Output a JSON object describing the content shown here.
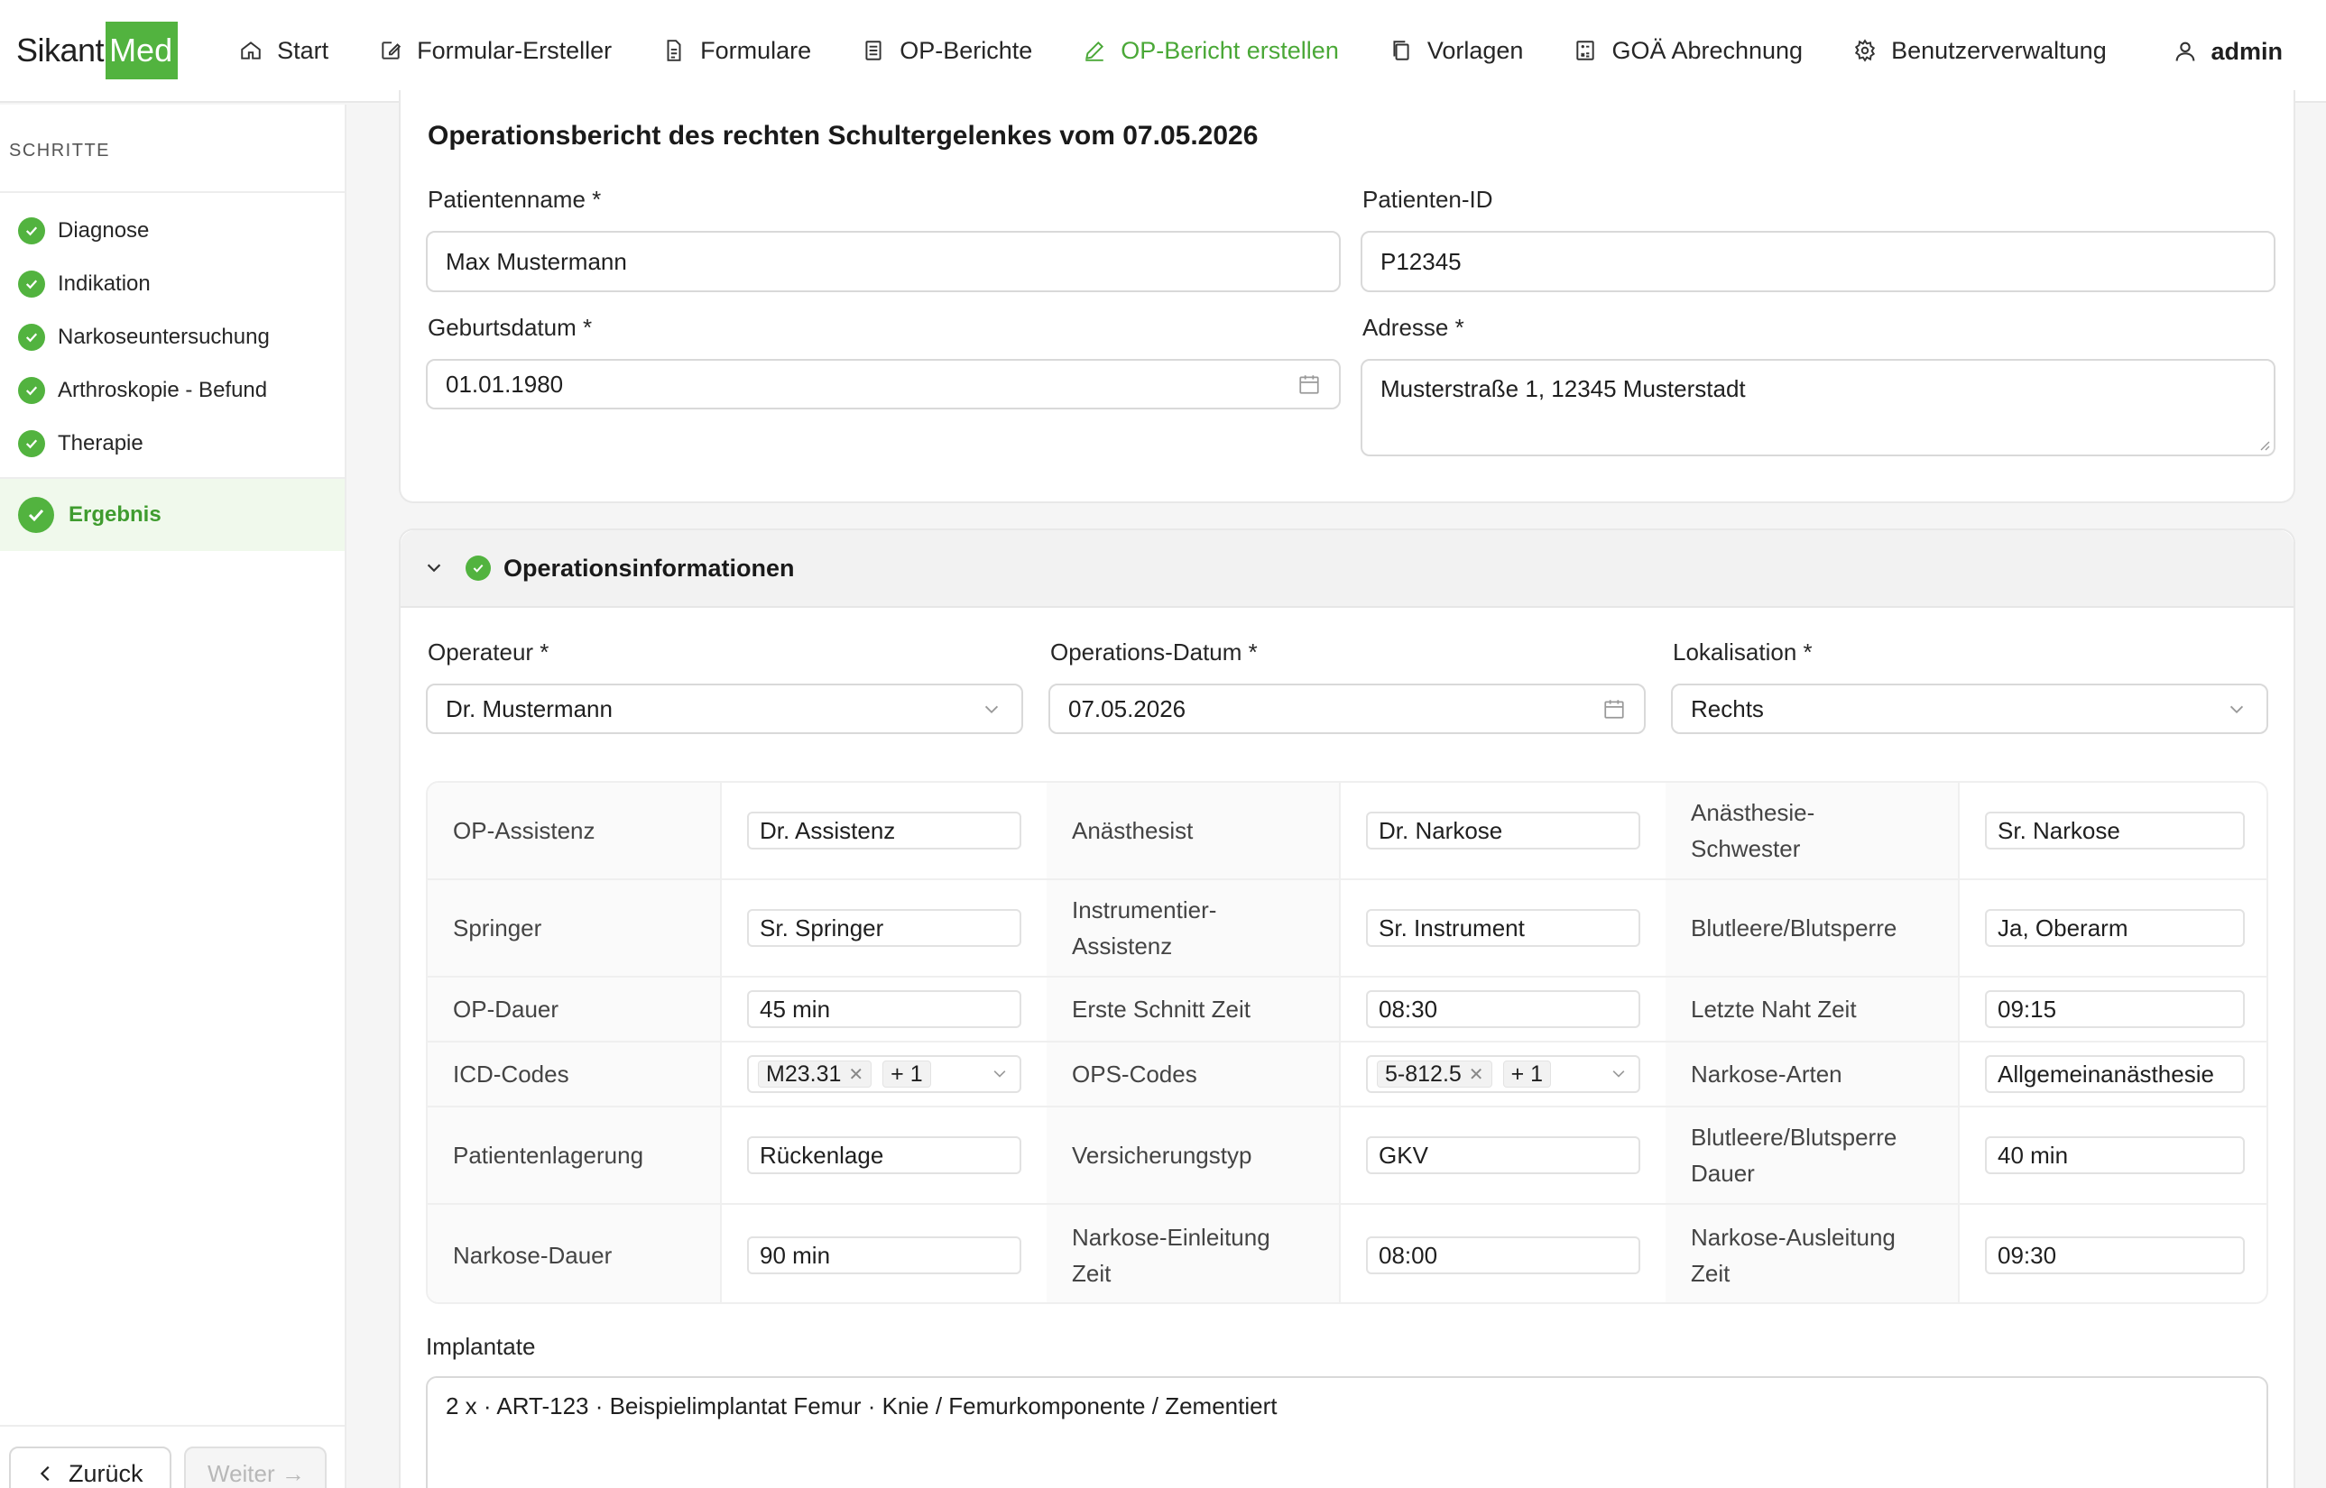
{
  "brand": {
    "name_part1": "Sikant",
    "name_part2": "Med"
  },
  "nav": {
    "items": [
      {
        "label": "Start",
        "icon": "home-icon"
      },
      {
        "label": "Formular-Ersteller",
        "icon": "edit-icon"
      },
      {
        "label": "Formulare",
        "icon": "document-icon"
      },
      {
        "label": "OP-Berichte",
        "icon": "list-icon"
      },
      {
        "label": "OP-Bericht erstellen",
        "icon": "pen-icon",
        "active": true
      },
      {
        "label": "Vorlagen",
        "icon": "copy-icon"
      },
      {
        "label": "GOÄ Abrechnung",
        "icon": "calculator-icon"
      },
      {
        "label": "Benutzerverwaltung",
        "icon": "gear-icon"
      }
    ],
    "user": "admin"
  },
  "sidebar": {
    "title": "SCHRITTE",
    "steps": [
      {
        "label": "Diagnose"
      },
      {
        "label": "Indikation"
      },
      {
        "label": "Narkoseuntersuchung"
      },
      {
        "label": "Arthroskopie - Befund"
      },
      {
        "label": "Therapie"
      }
    ],
    "active_step": "Ergebnis",
    "back_label": "Zurück",
    "next_label": "Weiter →"
  },
  "report": {
    "title": "Operationsbericht des rechten Schultergelenkes vom 07.05.2026",
    "patient_name_label": "Patientenname *",
    "patient_name": "Max Mustermann",
    "patient_id_label": "Patienten-ID",
    "patient_id": "P12345",
    "birthdate_label": "Geburtsdatum *",
    "birthdate": "01.01.1980",
    "address_label": "Adresse *",
    "address": "Musterstraße 1, 12345 Musterstadt"
  },
  "op_info": {
    "section_title": "Operationsinformationen",
    "operator_label": "Operateur *",
    "operator": "Dr. Mustermann",
    "date_label": "Operations-Datum *",
    "date": "07.05.2026",
    "location_label": "Lokalisation *",
    "location": "Rechts",
    "grid": [
      {
        "l1": "OP-Assistenz",
        "v1": "Dr. Assistenz",
        "l2": "Anästhesist",
        "v2": "Dr. Narkose",
        "l3": "Anästhesie-Schwester",
        "v3": "Sr. Narkose"
      },
      {
        "l1": "Springer",
        "v1": "Sr. Springer",
        "l2": "Instrumentier-Assistenz",
        "v2": "Sr. Instrument",
        "l3": "Blutleere/Blutsperre",
        "v3": "Ja, Oberarm"
      },
      {
        "l1": "OP-Dauer",
        "v1": "45 min",
        "l2": "Erste Schnitt Zeit",
        "v2": "08:30",
        "l3": "Letzte Naht Zeit",
        "v3": "09:15"
      },
      {
        "l1": "ICD-Codes",
        "v1_tag": "M23.31",
        "v1_more": "+ 1",
        "l2": "OPS-Codes",
        "v2_tag": "5-812.5",
        "v2_more": "+ 1",
        "l3": "Narkose-Arten",
        "v3": "Allgemeinanästhesie"
      },
      {
        "l1": "Patientenlagerung",
        "v1": "Rückenlage",
        "l2": "Versicherungstyp",
        "v2": "GKV",
        "l3": "Blutleere/Blutsperre Dauer",
        "v3": "40 min"
      },
      {
        "l1": "Narkose-Dauer",
        "v1": "90 min",
        "l2": "Narkose-Einleitung Zeit",
        "v2": "08:00",
        "l3": "Narkose-Ausleitung Zeit",
        "v3": "09:30"
      }
    ],
    "implants_label": "Implantate",
    "implants_text": "2 x · ART-123 · Beispielimplantat Femur · Knie / Femurkomponente / Zementiert"
  },
  "colors": {
    "accent": "#52b33f",
    "accent_text": "#4aa837"
  }
}
